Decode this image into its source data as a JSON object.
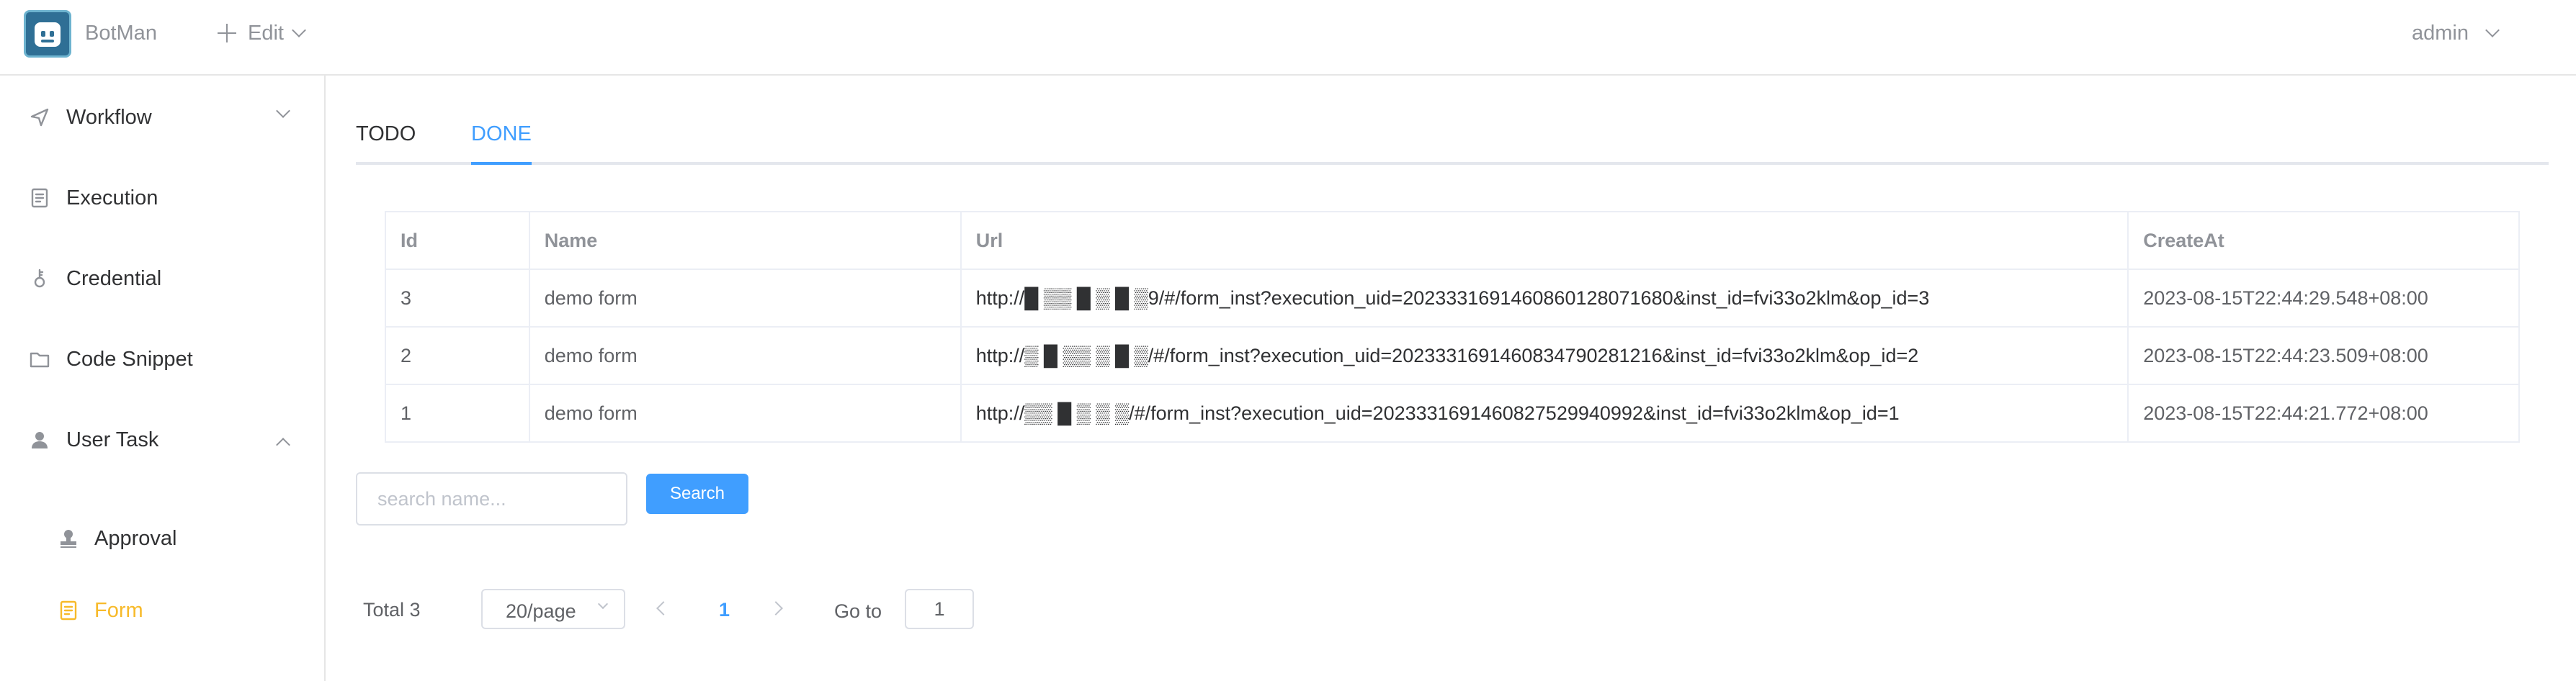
{
  "header": {
    "brand": "BotMan",
    "edit_label": "Edit",
    "user": "admin"
  },
  "sidebar": {
    "items": [
      {
        "label": "Workflow",
        "icon": "navigation-icon"
      },
      {
        "label": "Execution",
        "icon": "document-icon"
      },
      {
        "label": "Credential",
        "icon": "key-icon"
      },
      {
        "label": "Code Snippet",
        "icon": "folder-icon"
      },
      {
        "label": "User Task",
        "icon": "user-icon"
      }
    ],
    "subitems": [
      {
        "label": "Approval",
        "icon": "stamp-icon"
      },
      {
        "label": "Form",
        "icon": "form-icon",
        "active": true
      }
    ],
    "active_color": "#f7ba2a"
  },
  "tabs": [
    {
      "label": "TODO"
    },
    {
      "label": "DONE",
      "active": true
    }
  ],
  "table": {
    "headers": [
      "Id",
      "Name",
      "Url",
      "CreateAt"
    ],
    "rows": [
      {
        "id": "3",
        "name": "demo form",
        "url": "http://█ ▒▒ █ ▒ █ ▒9/#/form_inst?execution_uid=202333169146086012807168​0&inst_id=fvi33o2klm&op_id=3",
        "created": "2023-08-15T22:44:29.548+08:00"
      },
      {
        "id": "2",
        "name": "demo form",
        "url": "http://▒ █ ▒▒ ▒ █ ▒/#/form_inst?execution_uid=202333169146083479028121​6&inst_id=fvi33o2klm&op_id=2",
        "created": "2023-08-15T22:44:23.509+08:00"
      },
      {
        "id": "1",
        "name": "demo form",
        "url": "http://▒▒ █ ▒ ▒ ▒/#/form_inst?execution_uid=202333169146082752994099​2&inst_id=fvi33o2klm&op_id=1",
        "created": "2023-08-15T22:44:21.772+08:00"
      }
    ]
  },
  "search": {
    "placeholder": "search name...",
    "button": "Search"
  },
  "pagination": {
    "total_text": "Total 3",
    "page_size": "20/page",
    "current_page": "1",
    "goto_label": "Go to",
    "goto_value": "1"
  },
  "colors": {
    "primary": "#409eff",
    "active_nav": "#f7ba2a",
    "logo": "#2f6f95"
  }
}
